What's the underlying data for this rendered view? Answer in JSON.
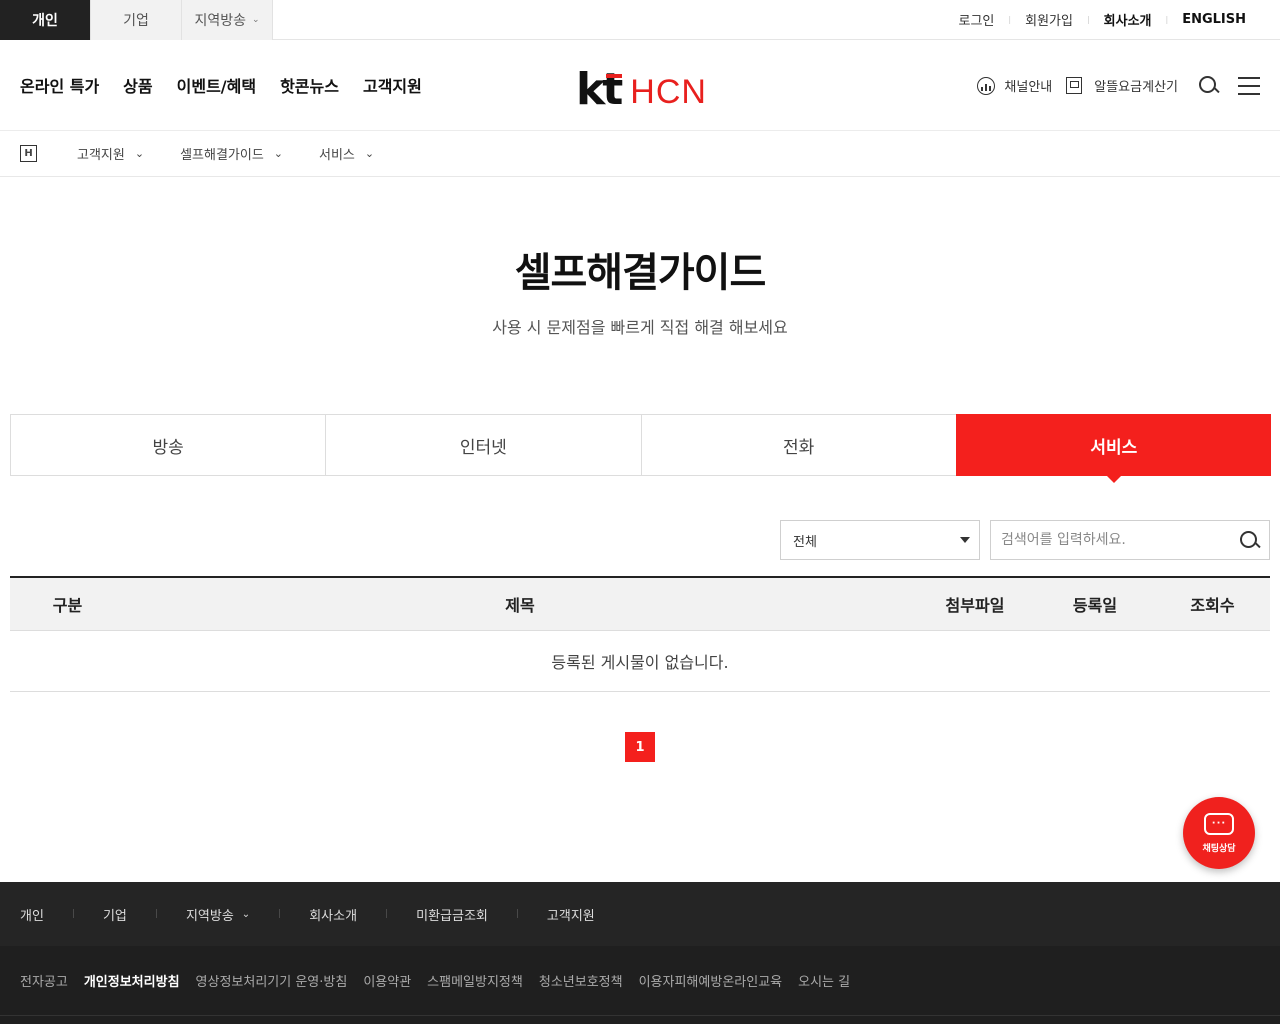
{
  "topbar": {
    "segments": [
      {
        "label": "개인",
        "active": true
      },
      {
        "label": "기업",
        "active": false
      },
      {
        "label": "지역방송",
        "active": false
      }
    ],
    "links": [
      "로그인",
      "회원가입",
      "회사소개",
      "ENGLISH"
    ]
  },
  "header": {
    "gnb": [
      "온라인 특가",
      "상품",
      "이벤트/혜택",
      "핫콘뉴스",
      "고객지원"
    ],
    "logo": {
      "kt": "kt",
      "hcn": "HCN"
    },
    "channel_guide": "채널안내",
    "calculator": "알뜰요금계산기"
  },
  "breadcrumb": {
    "home_glyph": "H",
    "items": [
      "고객지원",
      "셀프해결가이드",
      "서비스"
    ]
  },
  "page": {
    "title": "셀프해결가이드",
    "subtitle": "사용 시 문제점을 빠르게 직접 해결 해보세요"
  },
  "tabs": [
    {
      "label": "방송",
      "active": false
    },
    {
      "label": "인터넷",
      "active": false
    },
    {
      "label": "전화",
      "active": false
    },
    {
      "label": "서비스",
      "active": true
    }
  ],
  "filter": {
    "select_value": "전체",
    "search_placeholder": "검색어를 입력하세요."
  },
  "table": {
    "columns": [
      "구분",
      "제목",
      "첨부파일",
      "등록일",
      "조회수"
    ],
    "empty_message": "등록된 게시물이 없습니다."
  },
  "pagination": {
    "current": "1"
  },
  "chat": {
    "label": "채팅상담",
    "dots": "···"
  },
  "footer": {
    "nav": [
      "개인",
      "기업",
      "지역방송",
      "회사소개",
      "미환급금조회",
      "고객지원"
    ],
    "links": [
      "전자공고",
      "개인정보처리방침",
      "영상정보처리기기 운영·방침",
      "이용약관",
      "스팸메일방지정책",
      "청소년보호정책",
      "이용자피해예방온라인교육",
      "오시는 길"
    ]
  },
  "colors": {
    "accent": "#f4201d",
    "dark": "#222222",
    "footer": "#1f1f1f"
  }
}
